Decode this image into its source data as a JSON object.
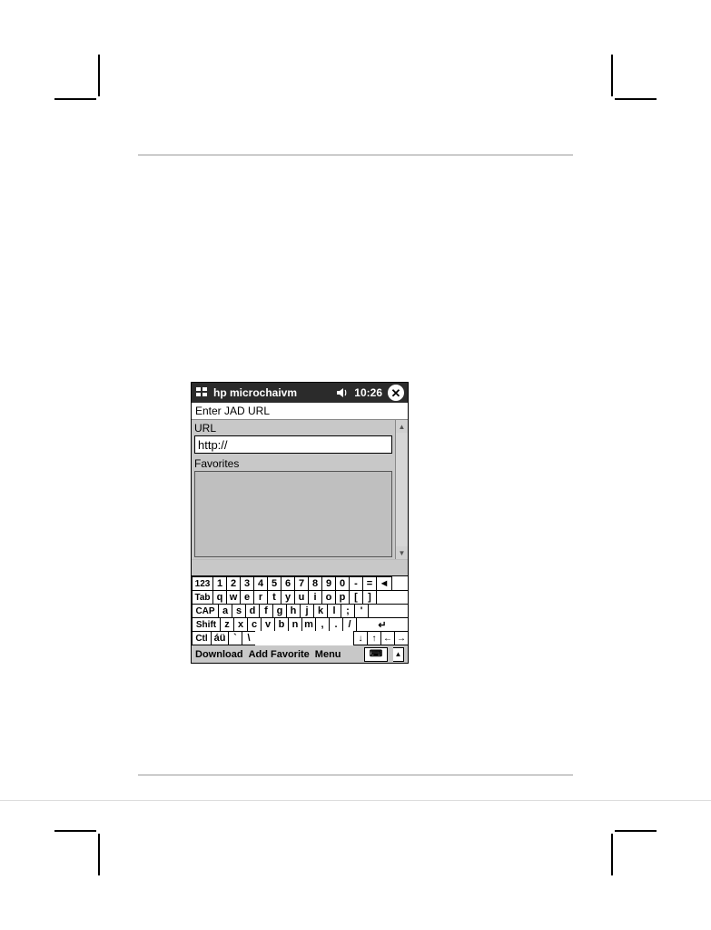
{
  "titlebar": {
    "app_name": "hp microchaivm",
    "time": "10:26"
  },
  "screen": {
    "subtitle": "Enter JAD URL",
    "url_label": "URL",
    "url_value": "http://",
    "favorites_label": "Favorites"
  },
  "keyboard": {
    "row1": [
      "123",
      "1",
      "2",
      "3",
      "4",
      "5",
      "6",
      "7",
      "8",
      "9",
      "0",
      "-",
      "=",
      "◄"
    ],
    "row2": [
      "Tab",
      "q",
      "w",
      "e",
      "r",
      "t",
      "y",
      "u",
      "i",
      "o",
      "p",
      "[",
      "]"
    ],
    "row3": [
      "CAP",
      "a",
      "s",
      "d",
      "f",
      "g",
      "h",
      "j",
      "k",
      "l",
      ";",
      "'"
    ],
    "row4": [
      "Shift",
      "z",
      "x",
      "c",
      "v",
      "b",
      "n",
      "m",
      ",",
      ".",
      "/",
      "↵"
    ],
    "row5_left": [
      "Ctl",
      "áü",
      "`",
      "\\"
    ],
    "row5_arrows": [
      "↓",
      "↑",
      "←",
      "→"
    ]
  },
  "bottombar": {
    "download": "Download",
    "add_favorite": "Add Favorite",
    "menu": "Menu"
  },
  "icons": {
    "close": "✕",
    "scroll_up": "▲",
    "scroll_down": "▼",
    "kbd_glyph": "⌨",
    "kbd_tri": "▲"
  }
}
